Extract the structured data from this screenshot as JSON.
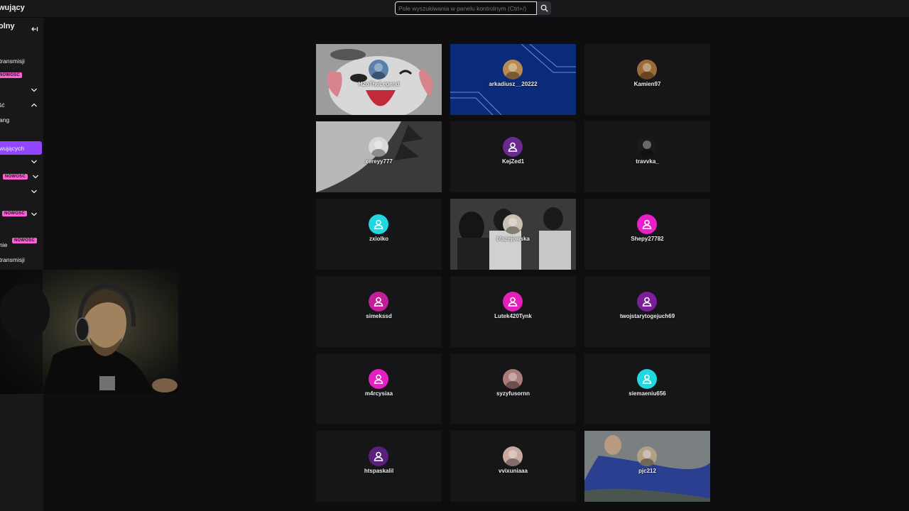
{
  "header": {
    "title_partial": "wujący",
    "search_placeholder": "Pole wyszukiwania w panelu kontrolnym (Ctrl+/)"
  },
  "sidebar": {
    "heading_partial": "olny",
    "item_transmisji_1": "transmisji",
    "badge_1": "NOWOŚĆ",
    "item_sc": "ść",
    "item_ang": "ang",
    "item_active": "wujących",
    "badge_2": "NOWOŚĆ",
    "badge_3": "NOWOŚĆ",
    "item_nie": "nie",
    "badge_4": "NOWOŚĆ",
    "item_transmisji_2": "transmisji"
  },
  "users": [
    {
      "name": "H2oTheLegend",
      "avatar": "photo-avatar",
      "avatar_color": "#5a7fa8"
    },
    {
      "name": "arkadiusz__20222",
      "avatar": "photo-avatar",
      "avatar_color": "#b88a52"
    },
    {
      "name": "Kamien97",
      "avatar": "photo-avatar",
      "avatar_color": "#9b6a38"
    },
    {
      "name": "xereyy777",
      "avatar": "photo-avatar",
      "avatar_color": "#d8d8d8"
    },
    {
      "name": "KejZed1",
      "avatar": "default-user-avatar",
      "avatar_color": "#6b2a8f"
    },
    {
      "name": "travvka_",
      "avatar": "photo-avatar",
      "avatar_color": "#1a1a1a"
    },
    {
      "name": "zxiolko",
      "avatar": "default-user-avatar",
      "avatar_color": "#1fd8e0"
    },
    {
      "name": "blazejowska",
      "avatar": "photo-avatar",
      "avatar_color": "#c8c0b0"
    },
    {
      "name": "Shepy27782",
      "avatar": "default-user-avatar",
      "avatar_color": "#ea1fc9"
    },
    {
      "name": "simekssd",
      "avatar": "default-user-avatar",
      "avatar_color": "#c21f99"
    },
    {
      "name": "Lutek420Tynk",
      "avatar": "default-user-avatar",
      "avatar_color": "#e51fb9"
    },
    {
      "name": "twojstarytogejuch69",
      "avatar": "default-user-avatar",
      "avatar_color": "#7a1f99"
    },
    {
      "name": "m4rcysiaa",
      "avatar": "default-user-avatar",
      "avatar_color": "#e51fc3"
    },
    {
      "name": "syzyfusornn",
      "avatar": "photo-avatar",
      "avatar_color": "#a87c78"
    },
    {
      "name": "siemaeniu656",
      "avatar": "default-user-avatar",
      "avatar_color": "#1fd8e0"
    },
    {
      "name": "htspaskalil",
      "avatar": "default-user-avatar",
      "avatar_color": "#5a1f7a"
    },
    {
      "name": "vvixuniaaa",
      "avatar": "photo-avatar",
      "avatar_color": "#c8a8a0"
    },
    {
      "name": "pjc212",
      "avatar": "photo-avatar",
      "avatar_color": "#b0a088"
    }
  ],
  "colors": {
    "accent": "#9147ff",
    "badge": "#ff5fd5",
    "background": "#0e0e10",
    "sidebar": "#18181b"
  }
}
